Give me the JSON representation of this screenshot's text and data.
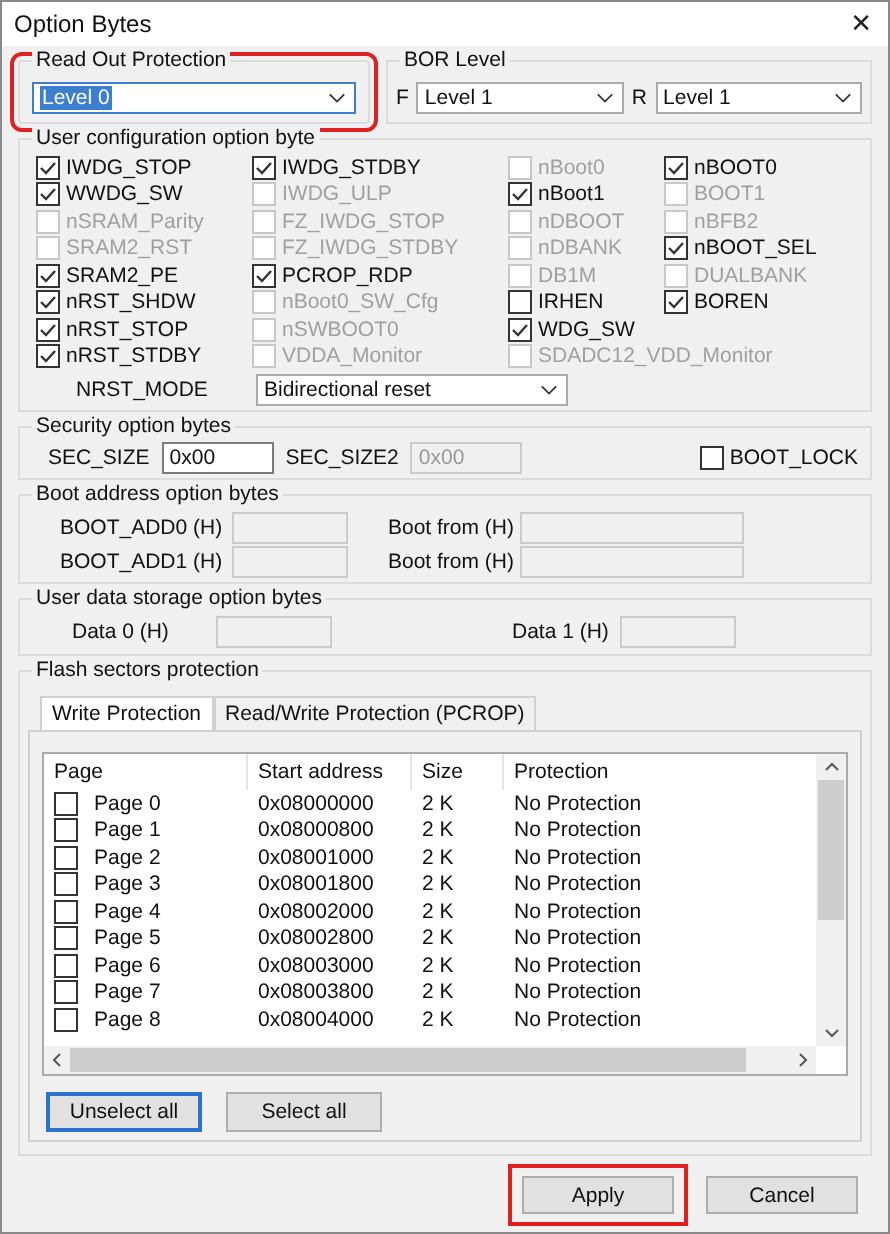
{
  "window": {
    "title": "Option Bytes",
    "close": "✕"
  },
  "read_out_protection": {
    "title": "Read Out Protection",
    "value": "Level 0",
    "highlighted": true
  },
  "bor_level": {
    "title": "BOR Level",
    "fields": [
      {
        "label": "F",
        "value": "Level 1"
      },
      {
        "label": "R",
        "value": "Level 1"
      }
    ]
  },
  "user_config": {
    "title": "User configuration option byte",
    "rows": [
      [
        {
          "label": "IWDG_STOP",
          "checked": true,
          "disabled": false
        },
        {
          "label": "IWDG_STDBY",
          "checked": true,
          "disabled": false
        },
        {
          "label": "nBoot0",
          "checked": false,
          "disabled": true
        },
        {
          "label": "nBOOT0",
          "checked": true,
          "disabled": false
        }
      ],
      [
        {
          "label": "WWDG_SW",
          "checked": true,
          "disabled": false
        },
        {
          "label": "IWDG_ULP",
          "checked": false,
          "disabled": true
        },
        {
          "label": "nBoot1",
          "checked": true,
          "disabled": false
        },
        {
          "label": "BOOT1",
          "checked": false,
          "disabled": true
        }
      ],
      [
        {
          "label": "nSRAM_Parity",
          "checked": false,
          "disabled": true
        },
        {
          "label": "FZ_IWDG_STOP",
          "checked": false,
          "disabled": true
        },
        {
          "label": "nDBOOT",
          "checked": false,
          "disabled": true
        },
        {
          "label": "nBFB2",
          "checked": false,
          "disabled": true
        }
      ],
      [
        {
          "label": "SRAM2_RST",
          "checked": false,
          "disabled": true
        },
        {
          "label": "FZ_IWDG_STDBY",
          "checked": false,
          "disabled": true
        },
        {
          "label": "nDBANK",
          "checked": false,
          "disabled": true
        },
        {
          "label": "nBOOT_SEL",
          "checked": true,
          "disabled": false
        }
      ],
      [
        {
          "label": "SRAM2_PE",
          "checked": true,
          "disabled": false
        },
        {
          "label": "PCROP_RDP",
          "checked": true,
          "disabled": false
        },
        {
          "label": "DB1M",
          "checked": false,
          "disabled": true
        },
        {
          "label": "DUALBANK",
          "checked": false,
          "disabled": true
        }
      ],
      [
        {
          "label": "nRST_SHDW",
          "checked": true,
          "disabled": false
        },
        {
          "label": "nBoot0_SW_Cfg",
          "checked": false,
          "disabled": true
        },
        {
          "label": "IRHEN",
          "checked": false,
          "disabled": false
        },
        {
          "label": "BOREN",
          "checked": true,
          "disabled": false
        }
      ],
      [
        {
          "label": "nRST_STOP",
          "checked": true,
          "disabled": false
        },
        {
          "label": "nSWBOOT0",
          "checked": false,
          "disabled": true
        },
        {
          "label": "WDG_SW",
          "checked": true,
          "disabled": false
        }
      ],
      [
        {
          "label": "nRST_STDBY",
          "checked": true,
          "disabled": false
        },
        {
          "label": "VDDA_Monitor",
          "checked": false,
          "disabled": true
        },
        {
          "label": "SDADC12_VDD_Monitor",
          "checked": false,
          "disabled": true
        }
      ]
    ],
    "nrst_mode": {
      "label": "NRST_MODE",
      "value": "Bidirectional reset"
    }
  },
  "security": {
    "title": "Security option bytes",
    "sec_size": {
      "label": "SEC_SIZE",
      "value": "0x00",
      "disabled": false
    },
    "sec_size2": {
      "label": "SEC_SIZE2",
      "value": "0x00",
      "disabled": true
    },
    "boot_lock": {
      "label": "BOOT_LOCK",
      "checked": false
    }
  },
  "boot_address": {
    "title": "Boot address option bytes",
    "rows": [
      {
        "label": "BOOT_ADD0 (H)",
        "from_label": "Boot from (H)"
      },
      {
        "label": "BOOT_ADD1 (H)",
        "from_label": "Boot from (H)"
      }
    ]
  },
  "user_data": {
    "title": "User data storage option bytes",
    "fields": [
      {
        "label": "Data 0 (H)"
      },
      {
        "label": "Data 1 (H)"
      }
    ]
  },
  "flash": {
    "title": "Flash sectors protection",
    "tabs": [
      {
        "label": "Write Protection",
        "selected": true
      },
      {
        "label": "Read/Write Protection (PCROP)",
        "selected": false
      }
    ],
    "columns": [
      "Page",
      "Start address",
      "Size",
      "Protection"
    ],
    "rows": [
      {
        "page": "Page 0",
        "address": "0x08000000",
        "size": "2 K",
        "protection": "No Protection",
        "checked": false
      },
      {
        "page": "Page 1",
        "address": "0x08000800",
        "size": "2 K",
        "protection": "No Protection",
        "checked": false
      },
      {
        "page": "Page 2",
        "address": "0x08001000",
        "size": "2 K",
        "protection": "No Protection",
        "checked": false
      },
      {
        "page": "Page 3",
        "address": "0x08001800",
        "size": "2 K",
        "protection": "No Protection",
        "checked": false
      },
      {
        "page": "Page 4",
        "address": "0x08002000",
        "size": "2 K",
        "protection": "No Protection",
        "checked": false
      },
      {
        "page": "Page 5",
        "address": "0x08002800",
        "size": "2 K",
        "protection": "No Protection",
        "checked": false
      },
      {
        "page": "Page 6",
        "address": "0x08003000",
        "size": "2 K",
        "protection": "No Protection",
        "checked": false
      },
      {
        "page": "Page 7",
        "address": "0x08003800",
        "size": "2 K",
        "protection": "No Protection",
        "checked": false
      },
      {
        "page": "Page 8",
        "address": "0x08004000",
        "size": "2 K",
        "protection": "No Protection",
        "checked": false
      }
    ],
    "buttons": [
      {
        "label": "Unselect all",
        "focused": true
      },
      {
        "label": "Select all",
        "focused": false
      }
    ]
  },
  "buttons": [
    {
      "label": "Apply",
      "highlighted": true
    },
    {
      "label": "Cancel",
      "highlighted": false
    }
  ]
}
